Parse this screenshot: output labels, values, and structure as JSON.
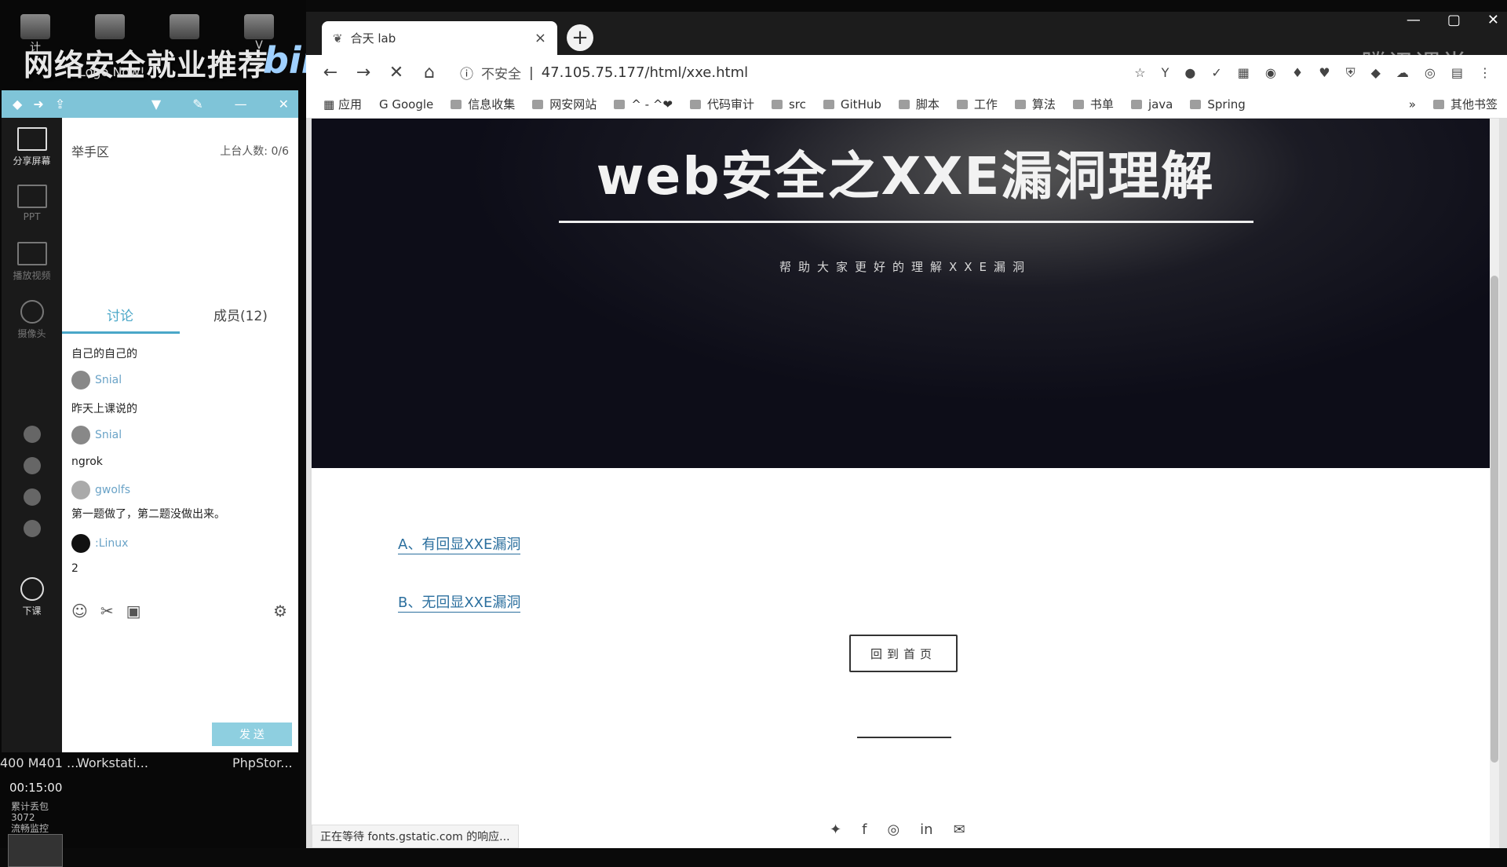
{
  "desktop": {
    "overlay_title": "网络安全就业推荐",
    "overlay_sub": "Logo Now!",
    "bili": "bili",
    "icons": [
      "计",
      "V"
    ],
    "taskbar": [
      "400 M401 ...",
      "Workstati...",
      "PhpStor..."
    ]
  },
  "chat": {
    "sidebar": {
      "share_screen": "分享屏幕",
      "ppt": "PPT",
      "play_video": "播放视频",
      "camera": "摄像头",
      "end_class": "下课",
      "timer": "00:15:00",
      "stats_1": "累计丢包",
      "stats_2": "3072",
      "stats_3": "流畅监控"
    },
    "handup_label": "举手区",
    "stage_count": "上台人数: 0/6",
    "tabs": {
      "discussion": "讨论",
      "members": "成员(12)"
    },
    "messages": [
      {
        "type": "text",
        "text": "自己的自己的"
      },
      {
        "type": "user",
        "name": "Snial"
      },
      {
        "type": "text",
        "text": "昨天上课说的"
      },
      {
        "type": "user",
        "name": "Snial"
      },
      {
        "type": "text",
        "text": "ngrok"
      },
      {
        "type": "user",
        "name": "gwolfs"
      },
      {
        "type": "text",
        "text": "第一题做了，第二题没做出来。"
      },
      {
        "type": "user",
        "name": ":Linux"
      },
      {
        "type": "text",
        "text": "2"
      }
    ],
    "send_label": "发 送"
  },
  "browser": {
    "tab_title": "合天 lab",
    "tab_close": "×",
    "newtab": "+",
    "insecure": "不安全",
    "url": "47.105.75.177/html/xxe.html",
    "watermark": "腾讯课堂",
    "bookmarks": [
      "应用",
      "Google",
      "信息收集",
      "网安网站",
      "^ - ^❤",
      "代码审计",
      "src",
      "GitHub",
      "脚本",
      "工作",
      "算法",
      "书单",
      "java",
      "Spring"
    ],
    "bookmark_more": "»",
    "other_bookmarks": "其他书签",
    "status": "正在等待 fonts.gstatic.com 的响应..."
  },
  "page": {
    "title": "web安全之XXE漏洞理解",
    "subtitle": "帮助大家更好的理解XXE漏洞",
    "link_a": "A、有回显XXE漏洞",
    "link_b": "B、无回显XXE漏洞",
    "home_button": "回到首页"
  },
  "icons": {
    "socials": [
      "twitter-icon",
      "facebook-icon",
      "instagram-icon",
      "linkedin-icon",
      "mail-icon"
    ]
  }
}
